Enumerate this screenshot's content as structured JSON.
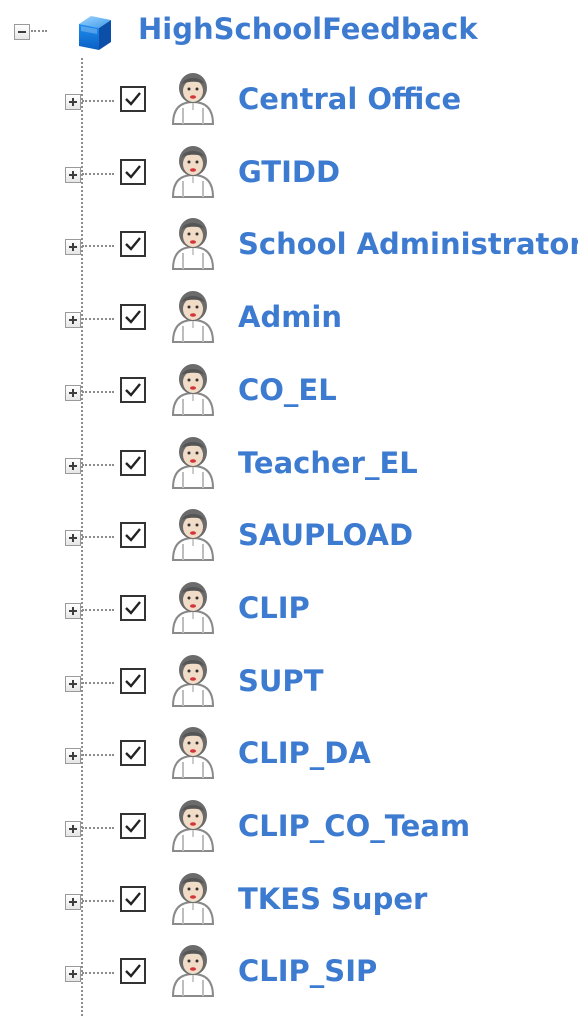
{
  "tree": {
    "root": {
      "label": "HighSchoolFeedback",
      "icon": "database-cube-icon",
      "expanded": true
    },
    "children": [
      {
        "label": "Central Office",
        "checked": true,
        "icon": "user-icon"
      },
      {
        "label": "GTIDD",
        "checked": true,
        "icon": "user-icon"
      },
      {
        "label": "School Administrator",
        "checked": true,
        "icon": "user-icon"
      },
      {
        "label": "Admin",
        "checked": true,
        "icon": "user-icon"
      },
      {
        "label": "CO_EL",
        "checked": true,
        "icon": "user-icon"
      },
      {
        "label": "Teacher_EL",
        "checked": true,
        "icon": "user-icon"
      },
      {
        "label": "SAUPLOAD",
        "checked": true,
        "icon": "user-icon"
      },
      {
        "label": "CLIP",
        "checked": true,
        "icon": "user-icon"
      },
      {
        "label": "SUPT",
        "checked": true,
        "icon": "user-icon"
      },
      {
        "label": "CLIP_DA",
        "checked": true,
        "icon": "user-icon"
      },
      {
        "label": "CLIP_CO_Team",
        "checked": true,
        "icon": "user-icon"
      },
      {
        "label": "TKES Super",
        "checked": true,
        "icon": "user-icon"
      },
      {
        "label": "CLIP_SIP",
        "checked": true,
        "icon": "user-icon"
      }
    ]
  },
  "colors": {
    "label": "#3d7bd1",
    "guide": "#8c8c8c"
  }
}
